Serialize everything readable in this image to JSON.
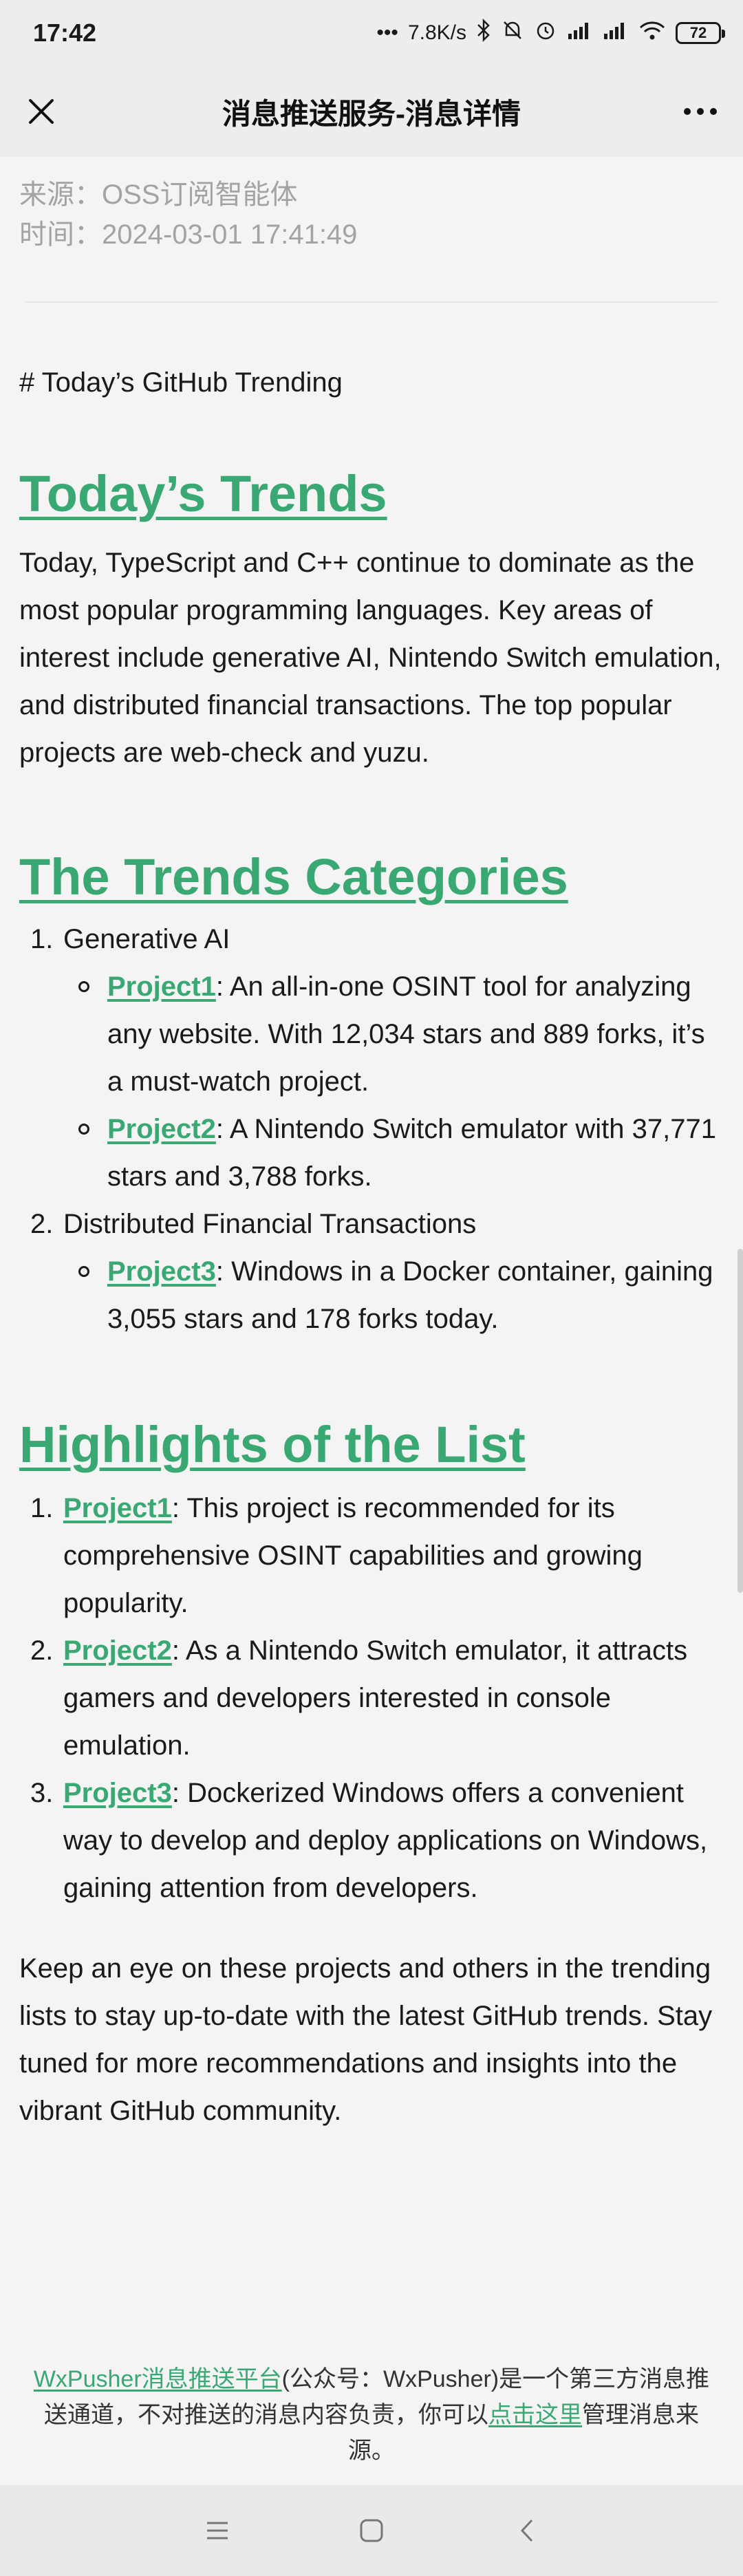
{
  "status": {
    "time": "17:42",
    "speed": "7.8K/s",
    "battery": "72"
  },
  "nav": {
    "title": "消息推送服务-消息详情"
  },
  "meta": {
    "source": "来源：OSS订阅智能体",
    "time": "时间：2024-03-01 17:41:49"
  },
  "article": {
    "raw_heading": "# Today’s GitHub Trending",
    "h_trends": "Today’s Trends",
    "trends_paragraph": "Today, TypeScript and C++ continue to dominate as the most popular programming languages. Key areas of interest include generative AI, Nintendo Switch emulation, and distributed financial transactions. The top popular projects are web-check and yuzu.",
    "h_categories": "The Trends Categories",
    "categories": [
      {
        "num": "1.",
        "label": "Generative AI",
        "items": [
          {
            "link": "Project1",
            "text": ": An all-in-one OSINT tool for analyzing any website. With 12,034 stars and 889 forks, it’s a must-watch project."
          },
          {
            "link": "Project2",
            "text": ": A Nintendo Switch emulator with 37,771 stars and 3,788 forks."
          }
        ]
      },
      {
        "num": "2.",
        "label": "Distributed Financial Transactions",
        "items": [
          {
            "link": "Project3",
            "text": ": Windows in a Docker container, gaining 3,055 stars and 178 forks today."
          }
        ]
      }
    ],
    "h_highlights": "Highlights of the List",
    "highlights": [
      {
        "num": "1.",
        "link": "Project1",
        "text": ": This project is recommended for its comprehensive OSINT capabilities and growing popularity."
      },
      {
        "num": "2.",
        "link": "Project2",
        "text": ": As a Nintendo Switch emulator, it attracts gamers and developers interested in console emulation."
      },
      {
        "num": "3.",
        "link": "Project3",
        "text": ": Dockerized Windows offers a convenient way to develop and deploy applications on Windows, gaining attention from developers."
      }
    ],
    "closing_paragraph": "Keep an eye on these projects and others in the trending lists to stay up-to-date with the latest GitHub trends. Stay tuned for more recommendations and insights into the vibrant GitHub community."
  },
  "footer": {
    "platform_link": "WxPusher消息推送平台",
    "text_1": "(公众号：WxPusher)是一个第三方消息推送通道，不对推送的消息内容负责，你可以",
    "manage_link": "点击这里",
    "text_2": "管理消息来源。"
  },
  "colors": {
    "accent": "#3aa873",
    "meta_gray": "#a3a3a3",
    "bar_bg": "#ededed",
    "page_bg": "#f4f4f4"
  }
}
